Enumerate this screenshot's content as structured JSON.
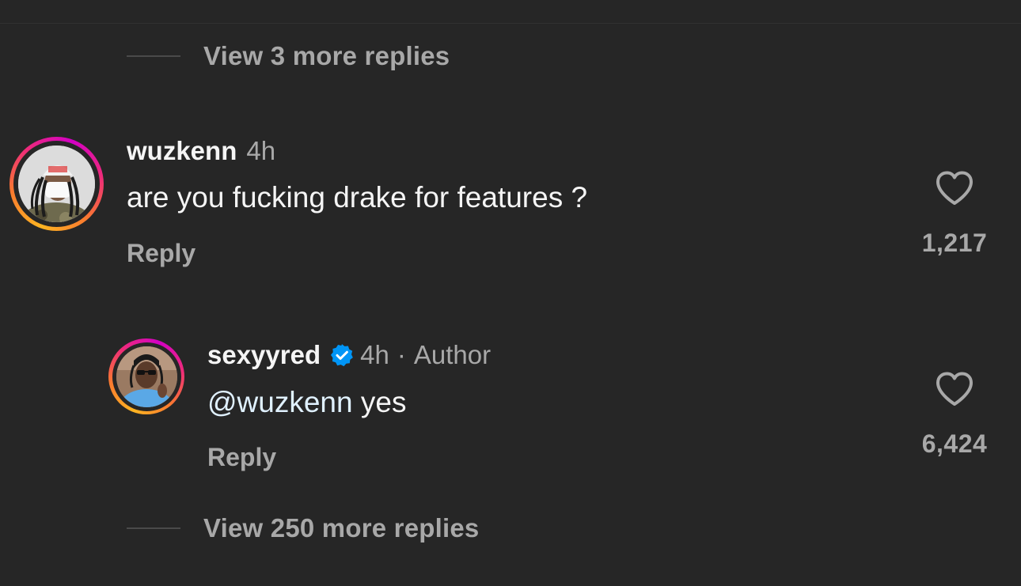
{
  "thread": {
    "view_more_top": "View 3 more replies",
    "view_more_bottom": "View 250 more replies"
  },
  "comment": {
    "username": "wuzkenn",
    "time": "4h",
    "text": "are you fucking drake for features ?",
    "reply_label": "Reply",
    "likes": "1,217"
  },
  "reply": {
    "username": "sexyyred",
    "verified": true,
    "time": "4h",
    "separator": "·",
    "author_tag": "Author",
    "mention": "@wuzkenn",
    "text": " yes",
    "reply_label": "Reply",
    "likes": "6,424"
  },
  "colors": {
    "background": "#262626",
    "primary_text": "#f5f5f5",
    "secondary_text": "#a8a8a8",
    "mention": "#e0f1ff",
    "verified": "#0095f6"
  },
  "icons": {
    "like": "heart-outline-icon",
    "verified": "verified-badge-icon"
  }
}
